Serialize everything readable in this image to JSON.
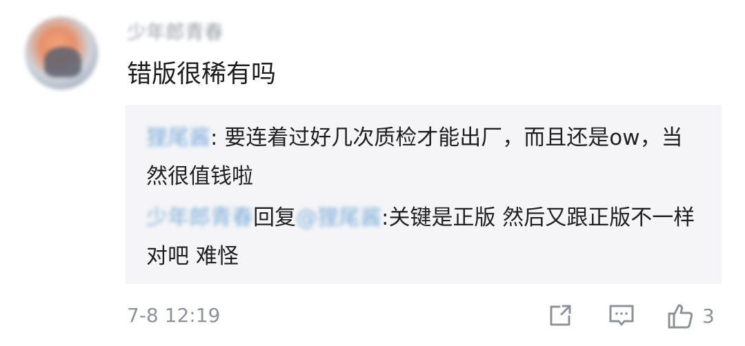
{
  "comment": {
    "username": "少年郎青春",
    "text": "错版很稀有吗",
    "time": "7-8 12:19",
    "like_count": "3"
  },
  "replies": [
    {
      "author": "狸尾酱",
      "separator": ":",
      "text": " 要连着过好几次质检才能出厂，而且还是ow，当然很值钱啦"
    },
    {
      "author": "少年郎青春",
      "reply_word": "回复",
      "target": "@狸尾酱",
      "separator": ":",
      "text": "关键是正版 然后又跟正版不一样对吧 难怪"
    }
  ],
  "icons": {
    "share": "share-icon",
    "comment": "comment-icon",
    "like": "thumbs-up-icon"
  },
  "colors": {
    "reply_background": "#f5f5f7",
    "name_link": "#7eaedc",
    "meta_gray": "#8e9198"
  }
}
